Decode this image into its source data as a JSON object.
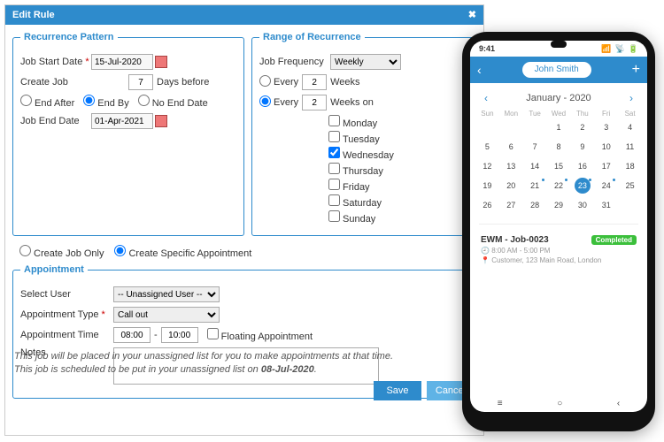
{
  "dialog": {
    "title": "Edit Rule",
    "recurrence": {
      "legend": "Recurrence Pattern",
      "start_lbl": "Job Start Date",
      "start_val": "15-Jul-2020",
      "create_lbl": "Create Job",
      "create_val": "7",
      "create_suffix": "Days before",
      "end_after": "End After",
      "end_by": "End By",
      "no_end": "No End Date",
      "end_lbl": "Job End Date",
      "end_val": "01-Apr-2021"
    },
    "range": {
      "legend": "Range of Recurrence",
      "freq_lbl": "Job Frequency",
      "freq_val": "Weekly",
      "every": "Every",
      "n1": "2",
      "unit1": "Weeks",
      "n2": "2",
      "unit2": "Weeks on",
      "days": [
        "Monday",
        "Tuesday",
        "Wednesday",
        "Thursday",
        "Friday",
        "Saturday",
        "Sunday"
      ],
      "checked_day": "Wednesday"
    },
    "mid": {
      "opt1": "Create Job Only",
      "opt2": "Create Specific Appointment"
    },
    "appt": {
      "legend": "Appointment",
      "user_lbl": "Select User",
      "user_val": "-- Unassigned User --",
      "type_lbl": "Appointment Type",
      "type_val": "Call out",
      "time_lbl": "Appointment Time",
      "t1": "08:00",
      "t2": "10:00",
      "float": "Floating Appointment",
      "notes_lbl": "Notes"
    },
    "note1": "This job will be placed in your unassigned list for you to make appointments at that time.",
    "note2a": "This job is scheduled to be put in your unassigned list on ",
    "note2b": "08-Jul-2020",
    "save": "Save",
    "cancel": "Cancel"
  },
  "phone": {
    "time": "9:41",
    "user": "John Smith",
    "month": "January - 2020",
    "dow": [
      "Sun",
      "Mon",
      "Tue",
      "Wed",
      "Thu",
      "Fri",
      "Sat"
    ],
    "job": {
      "title": "EWM - Job-0023",
      "status": "Completed",
      "time": "8:00 AM - 5:00 PM",
      "addr": "Customer, 123 Main Road, London"
    }
  }
}
